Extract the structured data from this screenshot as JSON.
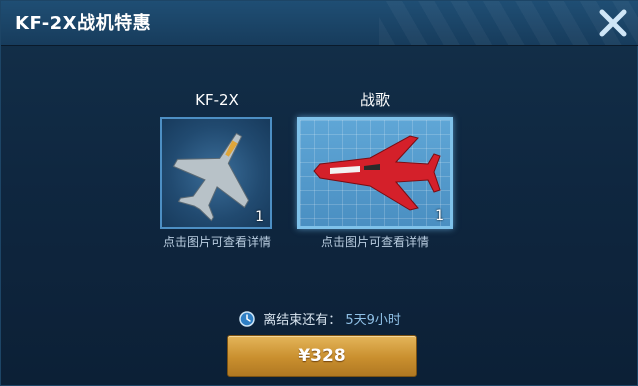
{
  "dialog": {
    "title": "KF-2X战机特惠",
    "close_icon": "close-icon"
  },
  "offers": [
    {
      "name": "KF-2X",
      "quantity": "1",
      "hint": "点击图片可查看详情",
      "image_icon": "grey-jet-fighter"
    },
    {
      "name": "战歌",
      "quantity": "1",
      "hint": "点击图片可查看详情",
      "image_icon": "red-jet-fighter"
    }
  ],
  "timer": {
    "label": "离结束还有：",
    "value": "5天9小时",
    "icon": "clock-icon"
  },
  "purchase": {
    "price": "¥328"
  },
  "colors": {
    "accent_gold": "#c98f2e",
    "panel_blue": "#0f2740",
    "timer_value": "#8fc0e6"
  }
}
